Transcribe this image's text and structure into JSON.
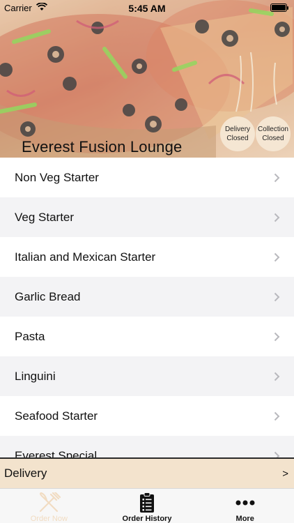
{
  "status_bar": {
    "carrier": "Carrier",
    "time": "5:45 AM"
  },
  "header": {
    "restaurant_name": "Everest Fusion Lounge",
    "badges": [
      {
        "line1": "Delivery",
        "line2": "Closed"
      },
      {
        "line1": "Collection",
        "line2": "Closed"
      }
    ]
  },
  "menu": {
    "items": [
      {
        "label": "Non Veg Starter"
      },
      {
        "label": "Veg Starter"
      },
      {
        "label": "Italian and Mexican Starter"
      },
      {
        "label": "Garlic Bread"
      },
      {
        "label": "Pasta"
      },
      {
        "label": "Linguini"
      },
      {
        "label": "Seafood Starter"
      },
      {
        "label": "Everest Special"
      }
    ]
  },
  "delivery_bar": {
    "label": "Delivery",
    "arrow": ">"
  },
  "tabbar": {
    "tabs": [
      {
        "label": "Order Now",
        "icon": "fork-knife-icon",
        "active": true
      },
      {
        "label": "Order History",
        "icon": "clipboard-list-icon",
        "active": false
      },
      {
        "label": "More",
        "icon": "ellipsis-icon",
        "active": false
      }
    ]
  },
  "colors": {
    "delivery_bar_bg": "#f3e3cd",
    "badge_bg": "#f5e8d6",
    "active_tab": "#f1dcc2",
    "row_alt_bg": "#f3f3f5"
  }
}
